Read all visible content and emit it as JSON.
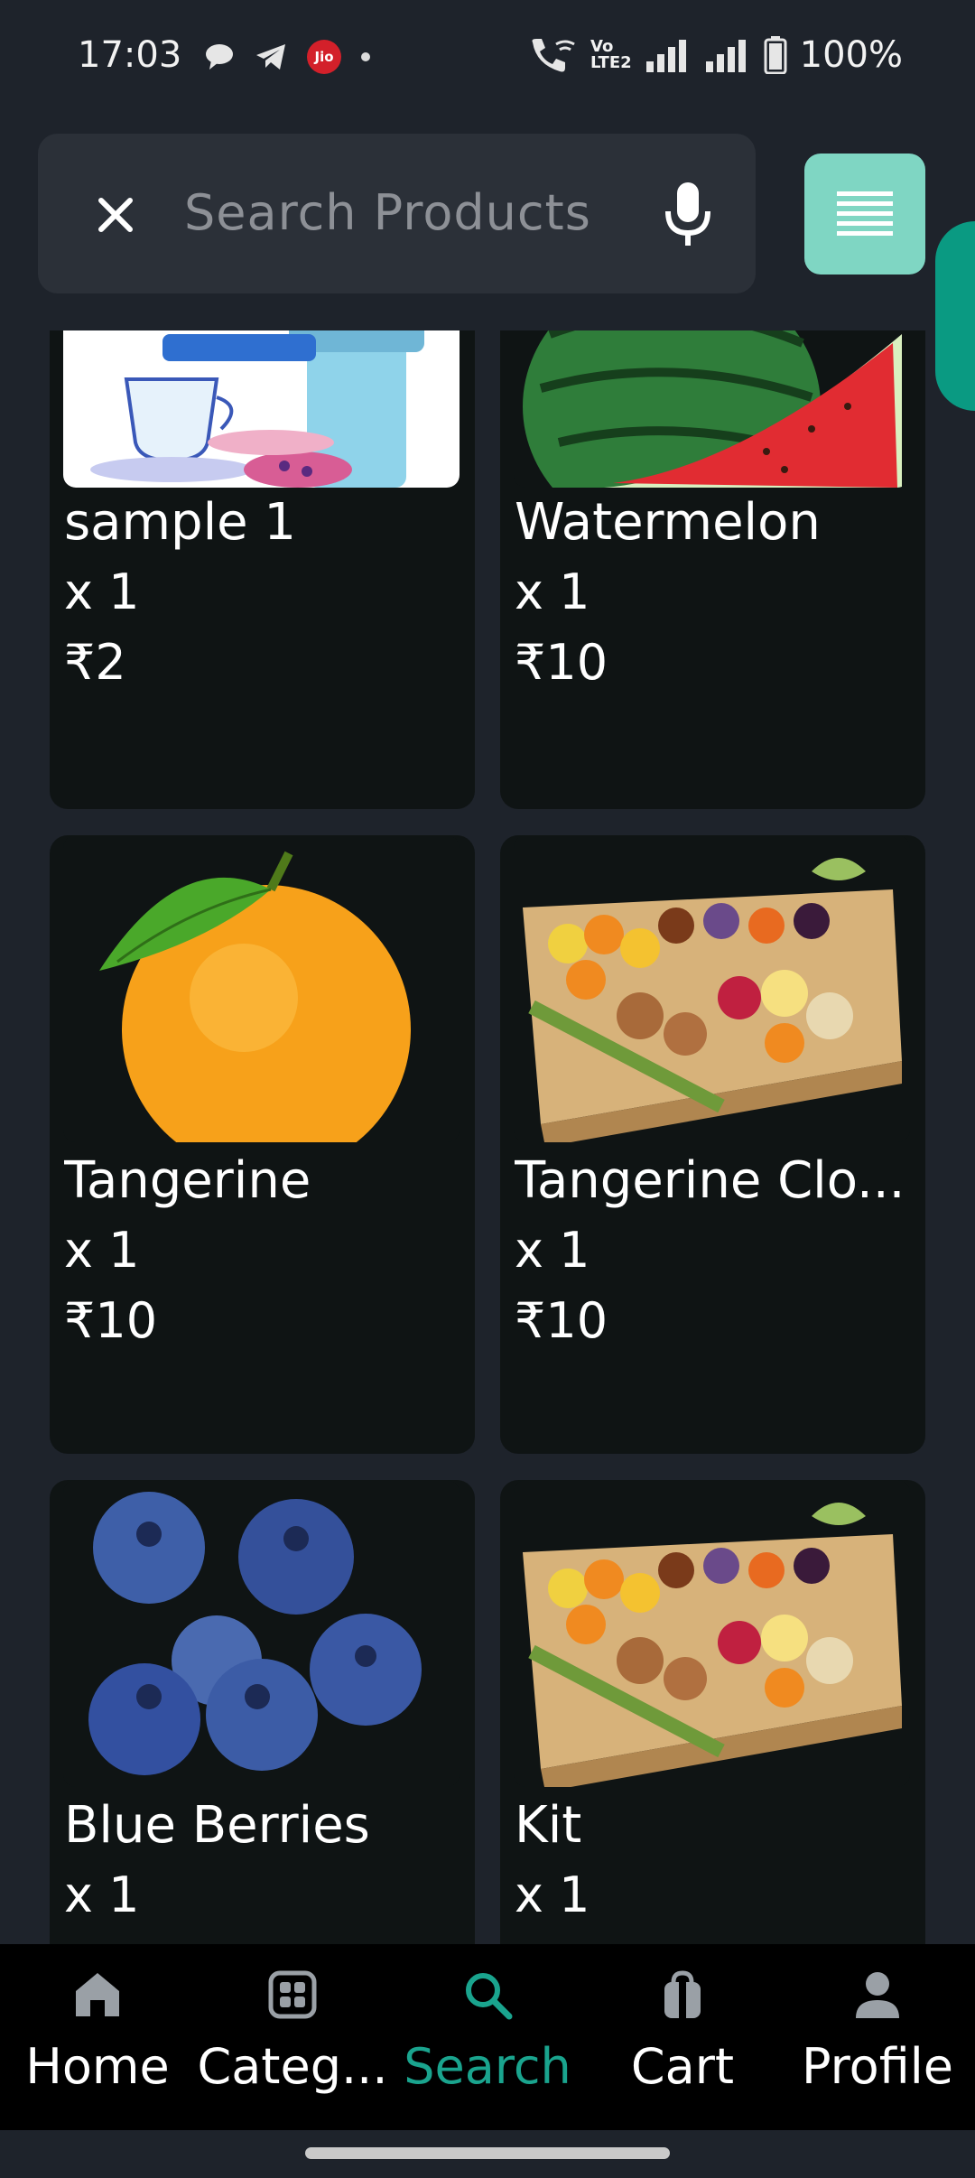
{
  "status_bar": {
    "time": "17:03",
    "jio_label": "Jio",
    "volte_top": "Vo",
    "volte_bottom": "LTE2",
    "battery": "100%"
  },
  "search": {
    "placeholder": "Search Products"
  },
  "products": [
    {
      "name": "sample 1",
      "qty": "x 1",
      "price": "₹2"
    },
    {
      "name": "Watermelon",
      "qty": "x 1",
      "price": "₹10"
    },
    {
      "name": "Tangerine",
      "qty": "x 1",
      "price": "₹10"
    },
    {
      "name": "Tangerine Clo...",
      "qty": "x 1",
      "price": "₹10"
    },
    {
      "name": "Blue Berries",
      "qty": "x 1",
      "price": ""
    },
    {
      "name": "Kit",
      "qty": "x 1",
      "price": ""
    }
  ],
  "bottom_nav": [
    {
      "label": "Home",
      "icon": "home-icon",
      "active": false
    },
    {
      "label": "Categ...",
      "icon": "grid-icon",
      "active": false
    },
    {
      "label": "Search",
      "icon": "search-icon",
      "active": true
    },
    {
      "label": "Cart",
      "icon": "shopping-bag-icon",
      "active": false
    },
    {
      "label": "Profile",
      "icon": "person-icon",
      "active": false
    }
  ],
  "colors": {
    "background": "#1e232b",
    "card": "#0f1414",
    "accent": "#1aa48e",
    "menu_button": "#7fd6c3"
  }
}
